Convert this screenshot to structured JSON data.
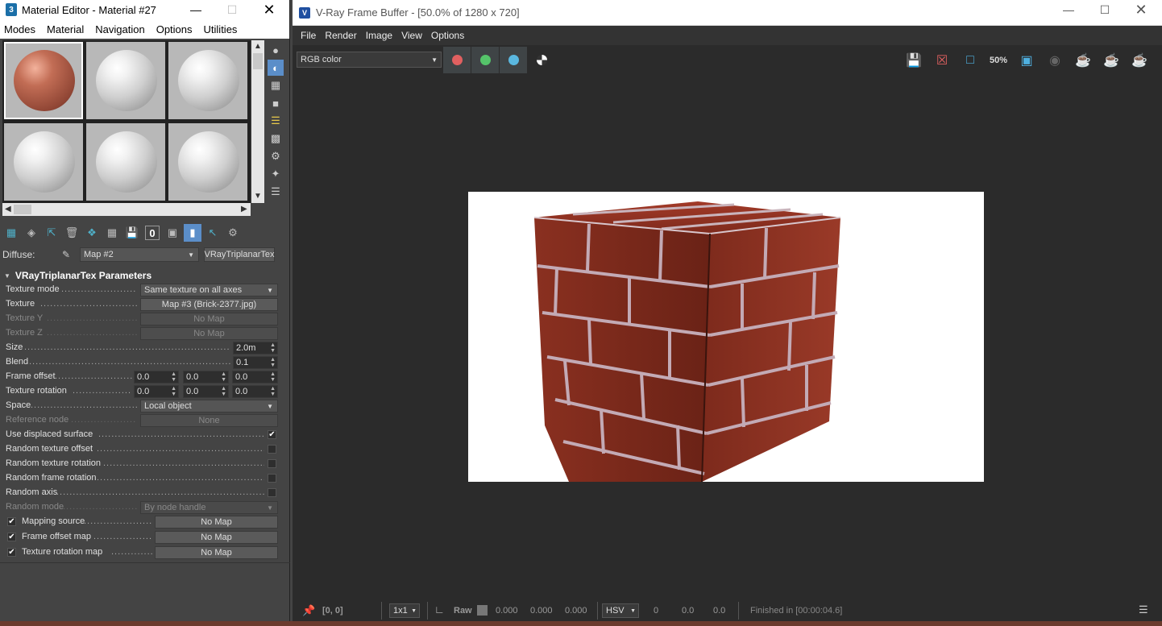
{
  "material_editor": {
    "title": "Material Editor - Material #27",
    "app_icon": "3",
    "menu": [
      "Modes",
      "Material",
      "Navigation",
      "Options",
      "Utilities"
    ],
    "diffuse_label": "Diffuse:",
    "diffuse_map": "Map #2",
    "diffuse_type": "VRayTriplanarTex",
    "rollout_title": "VRayTriplanarTex Parameters",
    "params": {
      "texture_mode_label": "Texture mode",
      "texture_mode_value": "Same texture on all axes",
      "texture_label": "Texture",
      "texture_value": "Map #3 (Brick-2377.jpg)",
      "texture_y_label": "Texture Y",
      "texture_y_value": "No Map",
      "texture_z_label": "Texture Z",
      "texture_z_value": "No Map",
      "size_label": "Size",
      "size_value": "2.0m",
      "blend_label": "Blend",
      "blend_value": "0.1",
      "frame_offset_label": "Frame offset",
      "frame_offset_values": [
        "0.0",
        "0.0",
        "0.0"
      ],
      "texture_rotation_label": "Texture rotation",
      "texture_rotation_values": [
        "0.0",
        "0.0",
        "0.0"
      ],
      "space_label": "Space",
      "space_value": "Local object",
      "reference_node_label": "Reference node",
      "reference_node_value": "None",
      "use_displaced_label": "Use displaced surface",
      "random_texture_offset_label": "Random texture offset",
      "random_texture_rotation_label": "Random texture rotation",
      "random_frame_rotation_label": "Random frame rotation",
      "random_axis_label": "Random axis",
      "random_mode_label": "Random mode",
      "random_mode_value": "By node handle",
      "mapping_source_label": "Mapping source",
      "mapping_source_value": "No Map",
      "frame_offset_map_label": "Frame offset map",
      "frame_offset_map_value": "No Map",
      "texture_rotation_map_label": "Texture rotation map",
      "texture_rotation_map_value": "No Map"
    },
    "icons": [
      "sphere-icon",
      "backlight-icon",
      "checker-background-icon",
      "sample-uv-icon",
      "video-color-check-icon",
      "make-preview-icon",
      "options-icon",
      "select-by-material-icon",
      "material-map-navigator-icon"
    ],
    "toolbar_icons": [
      "get-material-icon",
      "put-to-scene-icon",
      "assign-icon",
      "delete-icon",
      "make-unique-icon",
      "put-to-library-icon",
      "material-id-icon",
      "show-map-icon",
      "show-end-result-icon",
      "go-to-parent-icon",
      "go-forward-icon"
    ],
    "material_id_value": "0"
  },
  "frame_buffer": {
    "title": "V-Ray Frame Buffer - [50.0% of 1280 x 720]",
    "menu": [
      "File",
      "Render",
      "Image",
      "View",
      "Options"
    ],
    "channel": "RGB color",
    "zoom_label": "50%",
    "status": {
      "coords": "[0, 0]",
      "ratio": "1x1",
      "raw": "Raw",
      "r": "0.000",
      "g": "0.000",
      "b": "0.000",
      "color_mode": "HSV",
      "h": "0",
      "s": "0.0",
      "v": "0.0",
      "finished": "Finished in [00:00:04.6]"
    },
    "colors": {
      "red_channel": "#e05a5a",
      "green_channel": "#4cc46a",
      "blue_channel": "#5ab8e0",
      "brick": "#8c2b1e",
      "mortar": "#b9a3b0"
    }
  }
}
